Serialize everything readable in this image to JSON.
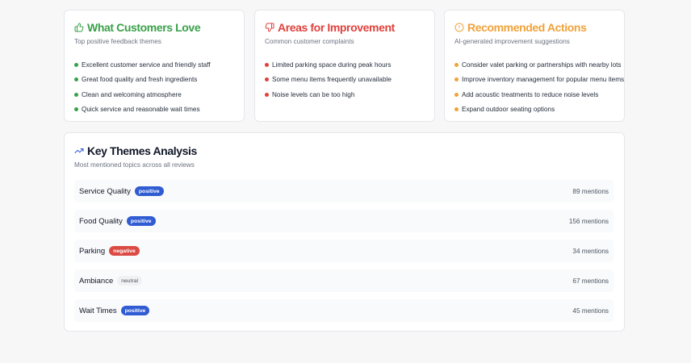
{
  "colors": {
    "positive": "#3aa14a",
    "negative": "#e0413c",
    "actions": "#f0a23a",
    "badge_positive": "#2f5bd3",
    "badge_negative": "#dc4a44",
    "badge_neutral": "#f0f1f3"
  },
  "love": {
    "icon": "thumbs-up-icon",
    "title": "What Customers Love",
    "subtitle": "Top positive feedback themes",
    "items": [
      "Excellent customer service and friendly staff",
      "Great food quality and fresh ingredients",
      "Clean and welcoming atmosphere",
      "Quick service and reasonable wait times"
    ]
  },
  "improve": {
    "icon": "thumbs-down-icon",
    "title": "Areas for Improvement",
    "subtitle": "Common customer complaints",
    "items": [
      "Limited parking space during peak hours",
      "Some menu items frequently unavailable",
      "Noise levels can be too high"
    ]
  },
  "actions": {
    "icon": "alert-circle-icon",
    "title": "Recommended Actions",
    "subtitle": "AI-generated improvement suggestions",
    "items": [
      "Consider valet parking or partnerships with nearby lots",
      "Improve inventory management for popular menu items",
      "Add acoustic treatments to reduce noise levels",
      "Expand outdoor seating options"
    ]
  },
  "themes": {
    "icon": "trending-up-icon",
    "title": "Key Themes Analysis",
    "subtitle": "Most mentioned topics across all reviews",
    "rows": [
      {
        "name": "Service Quality",
        "sentiment": "positive",
        "mentions": "89 mentions"
      },
      {
        "name": "Food Quality",
        "sentiment": "positive",
        "mentions": "156 mentions"
      },
      {
        "name": "Parking",
        "sentiment": "negative",
        "mentions": "34 mentions"
      },
      {
        "name": "Ambiance",
        "sentiment": "neutral",
        "mentions": "67 mentions"
      },
      {
        "name": "Wait Times",
        "sentiment": "positive",
        "mentions": "45 mentions"
      }
    ]
  }
}
